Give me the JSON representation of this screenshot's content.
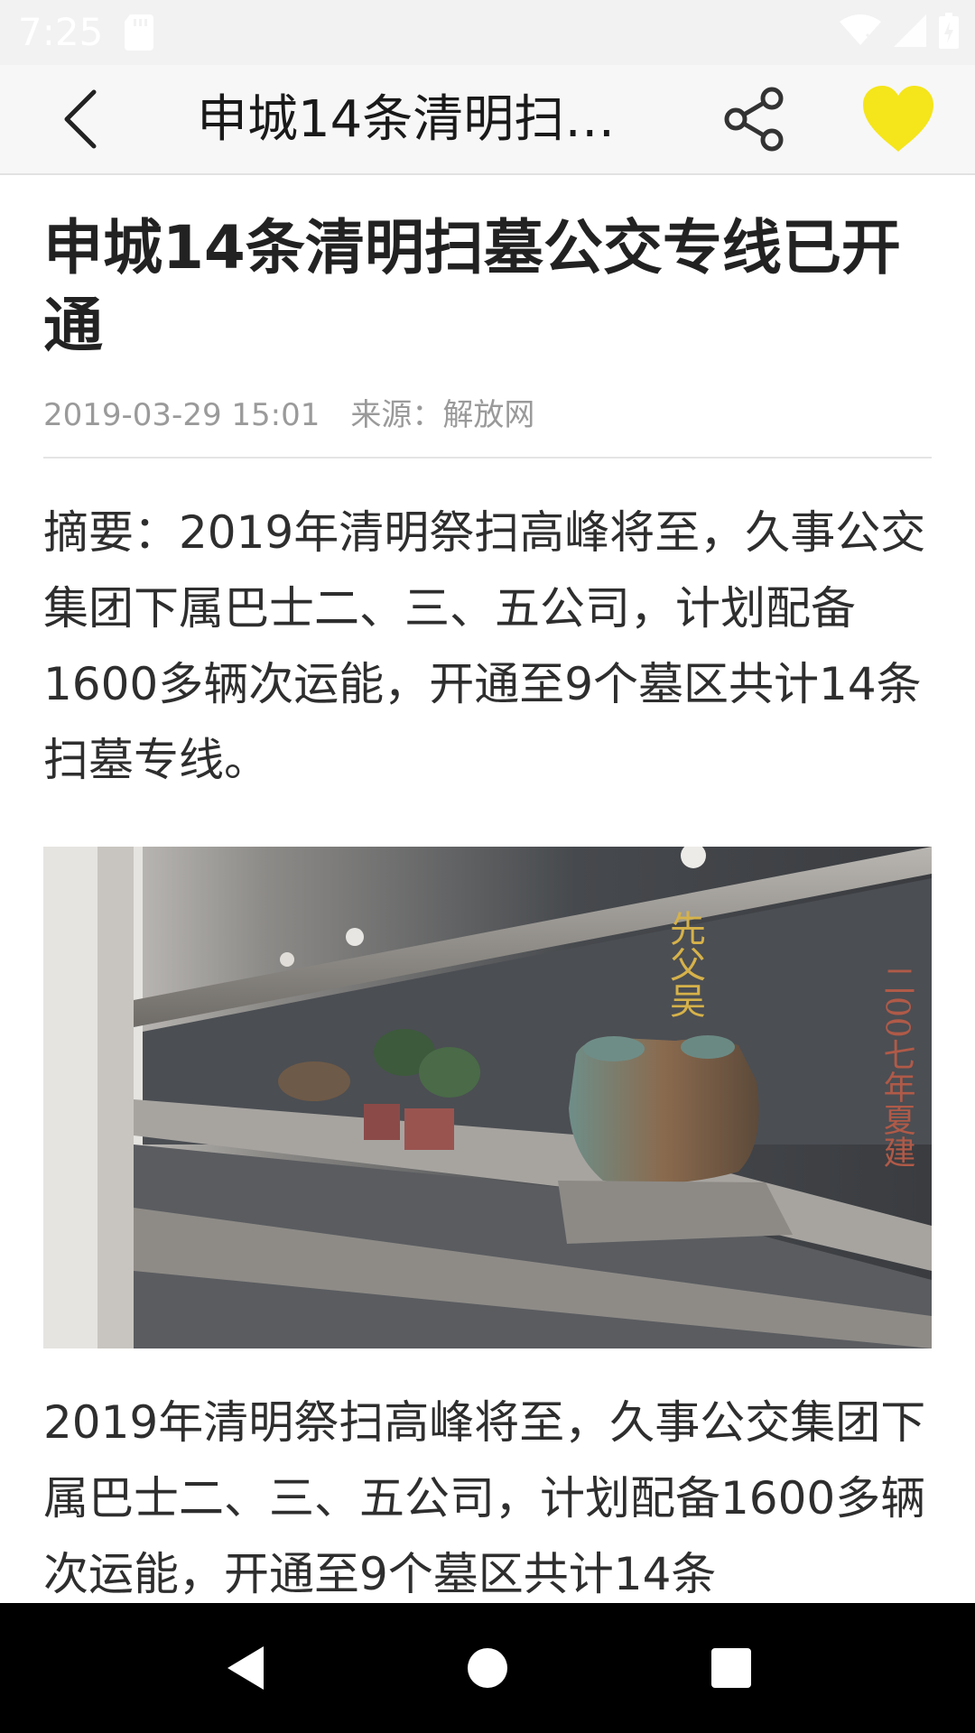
{
  "status_bar": {
    "time": "7:25",
    "icons": [
      "sd-card-icon",
      "wifi-icon",
      "signal-icon",
      "battery-icon"
    ]
  },
  "toolbar": {
    "title": "申城14条清明扫…",
    "back_icon": "chevron-left-icon",
    "share_icon": "share-icon",
    "favorite_icon": "heart-icon",
    "favorite_color": "#f5e51b"
  },
  "article": {
    "title": "申城14条清明扫墓公交专线已开通",
    "date": "2019-03-29 15:01",
    "source": "来源：解放网",
    "summary": "摘要：2019年清明祭扫高峰将至，久事公交集团下属巴士二、三、五公司，计划配备1600多辆次运能，开通至9个墓区共计14条扫墓专线。",
    "image": {
      "inscriptions": [
        "先父吴",
        "二00七年夏建"
      ]
    },
    "body": "2019年清明祭扫高峰将至，久事公交集团下属巴士二、三、五公司，计划配备1600多辆次运能，开通至9个墓区共计14条"
  },
  "nav_bar": {
    "buttons": [
      "nav-back-icon",
      "nav-home-icon",
      "nav-recents-icon"
    ]
  }
}
